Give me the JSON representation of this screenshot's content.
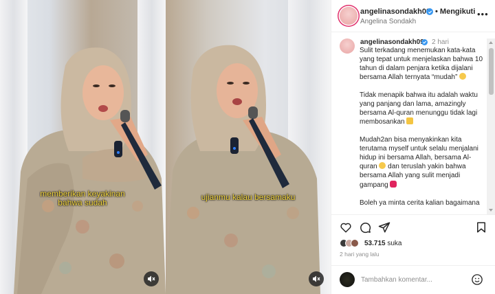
{
  "post": {
    "username": "angelinasondakh09",
    "follow_label": "Mengikuti",
    "full_name": "Angelina Sondakh",
    "more_label": "•••"
  },
  "caption": {
    "username": "angelinasondakh09",
    "time": "2 hari",
    "paragraphs": [
      "Sulit terkadang menemukan kata-kata yang tepat untuk menjelaskan bahwa 10 tahun di dalam penjara ketika dijalani bersama Allah ternyata “mudah”",
      "Tidak menapik bahwa itu adalah waktu yang panjang dan lama, amazingly bersama Al-quran menunggu tidak lagi membosankan",
      "Mudah2an bisa menyakinkan kita terutama myself untuk selalu menjalani hidup ini bersama Allah, bersama Al-quran",
      "dan teruslah yakin bahwa bersama Allah yang sulit menjadi gampang",
      "Boleh ya minta cerita kalian bagaimana"
    ]
  },
  "media": {
    "subtitle_left": "memberikan keyakinan bahwa sudah",
    "subtitle_right": "ujianmu kalau bersamaku"
  },
  "stats": {
    "likes_count": "53.715",
    "likes_label": "suka",
    "time_ago": "2 hari yang lalu"
  },
  "comment": {
    "placeholder": "Tambahkan komentar..."
  },
  "colors": {
    "accent": "#3897f0",
    "subtitle": "#f3d640",
    "heart": "#e0245e"
  }
}
